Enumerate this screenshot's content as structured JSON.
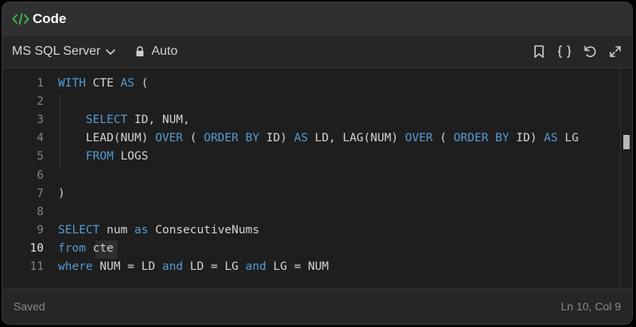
{
  "titlebar": {
    "title": "Code",
    "icon": "code-brackets-icon",
    "icon_color": "#3fb950"
  },
  "toolbar": {
    "language": "MS SQL Server",
    "mode": "Auto",
    "icons": [
      "bookmark-icon",
      "format-braces-icon",
      "reset-icon",
      "expand-icon"
    ]
  },
  "editor": {
    "active_line": 10,
    "line_numbers": [
      "1",
      "2",
      "3",
      "4",
      "5",
      "6",
      "7",
      "8",
      "9",
      "10",
      "11"
    ],
    "lines": [
      [
        {
          "t": "WITH",
          "k": true
        },
        {
          "t": " CTE "
        },
        {
          "t": "AS",
          "k": true
        },
        {
          "t": " ("
        }
      ],
      [],
      [
        {
          "t": "    "
        },
        {
          "t": "SELECT",
          "k": true
        },
        {
          "t": " ID, NUM,"
        }
      ],
      [
        {
          "t": "    LEAD(NUM) "
        },
        {
          "t": "OVER",
          "k": true
        },
        {
          "t": " ( "
        },
        {
          "t": "ORDER BY",
          "k": true
        },
        {
          "t": " ID) "
        },
        {
          "t": "AS",
          "k": true
        },
        {
          "t": " LD, LAG(NUM) "
        },
        {
          "t": "OVER",
          "k": true
        },
        {
          "t": " ( "
        },
        {
          "t": "ORDER BY",
          "k": true
        },
        {
          "t": " ID) "
        },
        {
          "t": "AS",
          "k": true
        },
        {
          "t": " LG"
        }
      ],
      [
        {
          "t": "    "
        },
        {
          "t": "FROM",
          "k": true
        },
        {
          "t": " LOGS"
        }
      ],
      [],
      [
        {
          "t": ")"
        }
      ],
      [],
      [
        {
          "t": "SELECT",
          "k": true
        },
        {
          "t": " num "
        },
        {
          "t": "as",
          "k": true
        },
        {
          "t": " ConsecutiveNums"
        }
      ],
      [
        {
          "t": "from",
          "k": true
        },
        {
          "t": " cte"
        }
      ],
      [
        {
          "t": "where",
          "k": true
        },
        {
          "t": " NUM = LD "
        },
        {
          "t": "and",
          "k": true
        },
        {
          "t": " LD = LG "
        },
        {
          "t": "and",
          "k": true
        },
        {
          "t": " LG = NUM"
        }
      ]
    ],
    "keyword_color": "#569cd6",
    "text_color": "#d4d4d4"
  },
  "status": {
    "left": "Saved",
    "right": "Ln 10, Col 9"
  }
}
